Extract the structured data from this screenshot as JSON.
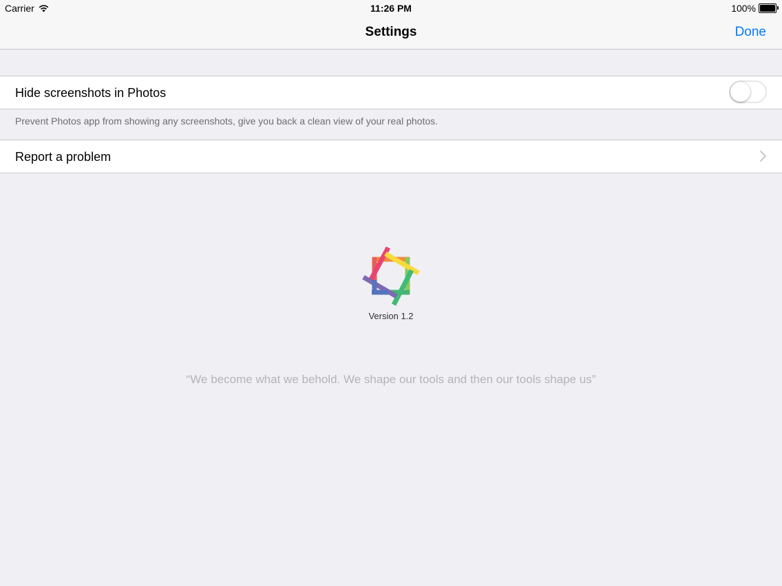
{
  "status_bar": {
    "carrier": "Carrier",
    "time": "11:26 PM",
    "battery": "100%"
  },
  "nav": {
    "title": "Settings",
    "done_label": "Done"
  },
  "settings": {
    "hide_screenshots": {
      "label": "Hide screenshots in Photos",
      "enabled": false,
      "footer": "Prevent Photos app from showing any screenshots, give you back a clean view of your real photos."
    },
    "report_problem": {
      "label": "Report a problem"
    }
  },
  "about": {
    "version": "Version 1.2",
    "quote": "“We become what we behold. We shape our tools and then our tools shape us”"
  },
  "icons": {
    "wifi": "wifi-icon",
    "battery": "battery-icon",
    "chevron": "chevron-right-icon",
    "logo": "app-logo"
  },
  "colors": {
    "accent": "#007aff",
    "background": "#efeff4",
    "separator": "#c8c7cc",
    "footer_text": "#6d6d72",
    "quote_text": "#b4b4b8"
  }
}
